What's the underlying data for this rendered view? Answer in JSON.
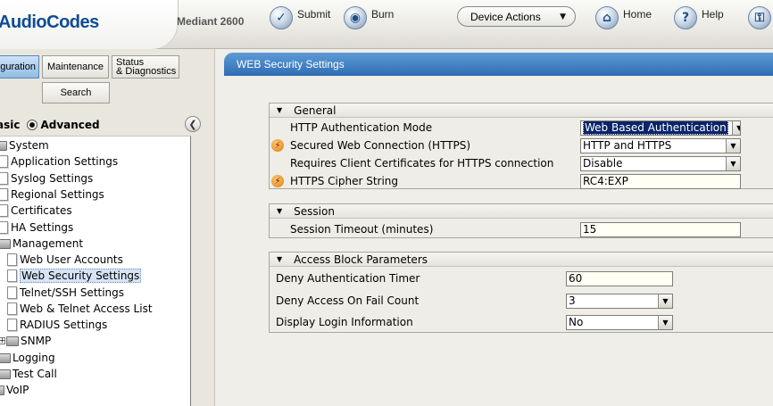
{
  "header": {
    "logo": "AudioCodes",
    "product": "Mediant 2600",
    "buttons": {
      "submit": "Submit",
      "burn": "Burn",
      "device_actions": "Device Actions",
      "home": "Home",
      "help": "Help"
    }
  },
  "nav": {
    "tabs": {
      "configuration": "guration",
      "maintenance": "Maintenance",
      "status_line1": "Status",
      "status_line2": "& Diagnostics",
      "search": "Search"
    },
    "mode": {
      "basic": "asic",
      "advanced": "Advanced"
    },
    "tree": {
      "system": "System",
      "application_settings": "Application Settings",
      "syslog_settings": "Syslog Settings",
      "regional_settings": "Regional Settings",
      "certificates": "Certificates",
      "ha_settings": "HA Settings",
      "management": "Management",
      "web_user_accounts": "Web User Accounts",
      "web_security_settings": "Web Security Settings",
      "telnet_ssh_settings": "Telnet/SSH Settings",
      "web_telnet_access_list": "Web & Telnet Access List",
      "radius_settings": "RADIUS Settings",
      "snmp": "SNMP",
      "logging": "Logging",
      "test_call": "Test Call",
      "voip": "VoIP"
    }
  },
  "page": {
    "title": "WEB Security Settings",
    "general": {
      "title": "General",
      "http_auth_mode": {
        "label": "HTTP Authentication Mode",
        "value": "Web Based Authentication"
      },
      "secured_web_conn": {
        "label": "Secured Web Connection (HTTPS)",
        "value": "HTTP and HTTPS"
      },
      "client_certs": {
        "label": "Requires Client Certificates for HTTPS connection",
        "value": "Disable"
      },
      "cipher_string": {
        "label": "HTTPS Cipher String",
        "value": "RC4:EXP"
      }
    },
    "session": {
      "title": "Session",
      "timeout": {
        "label": "Session Timeout (minutes)",
        "value": "15"
      }
    },
    "access_block": {
      "title": "Access Block Parameters",
      "deny_auth_timer": {
        "label": "Deny Authentication Timer",
        "value": "60"
      },
      "deny_fail_count": {
        "label": "Deny Access On Fail Count",
        "value": "3"
      },
      "display_login_info": {
        "label": "Display Login Information",
        "value": "No"
      }
    }
  },
  "colors": {
    "header_blue": "#2f6db3",
    "logo_blue": "#0f4c93",
    "selection": "#0a246a",
    "star_orange": "#e07a10"
  }
}
